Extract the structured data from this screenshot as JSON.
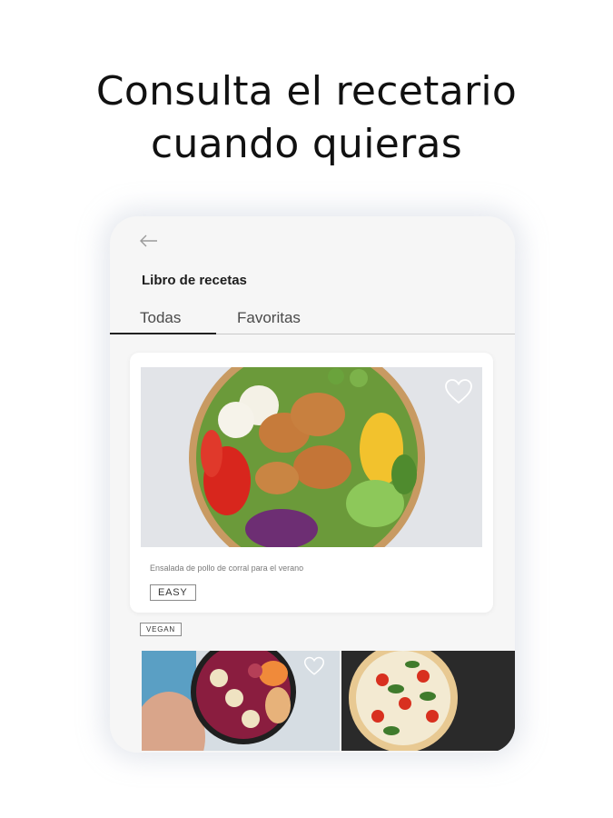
{
  "headline": {
    "line1": "Consulta el recetario",
    "line2": "cuando quieras"
  },
  "screen": {
    "back_icon": "arrow-left-icon",
    "title": "Libro de recetas",
    "tabs": [
      {
        "label": "Todas",
        "active": true
      },
      {
        "label": "Favoritas",
        "active": false
      }
    ]
  },
  "featured_recipe": {
    "description": "Ensalada de pollo de corral para el verano",
    "difficulty_tag": "EASY",
    "favorite_icon": "heart-outline-icon"
  },
  "next_section": {
    "tag": "VEGAN"
  },
  "colors": {
    "accent_underline": "#222222",
    "card_background": "#ffffff",
    "screen_background": "#f6f6f6"
  }
}
